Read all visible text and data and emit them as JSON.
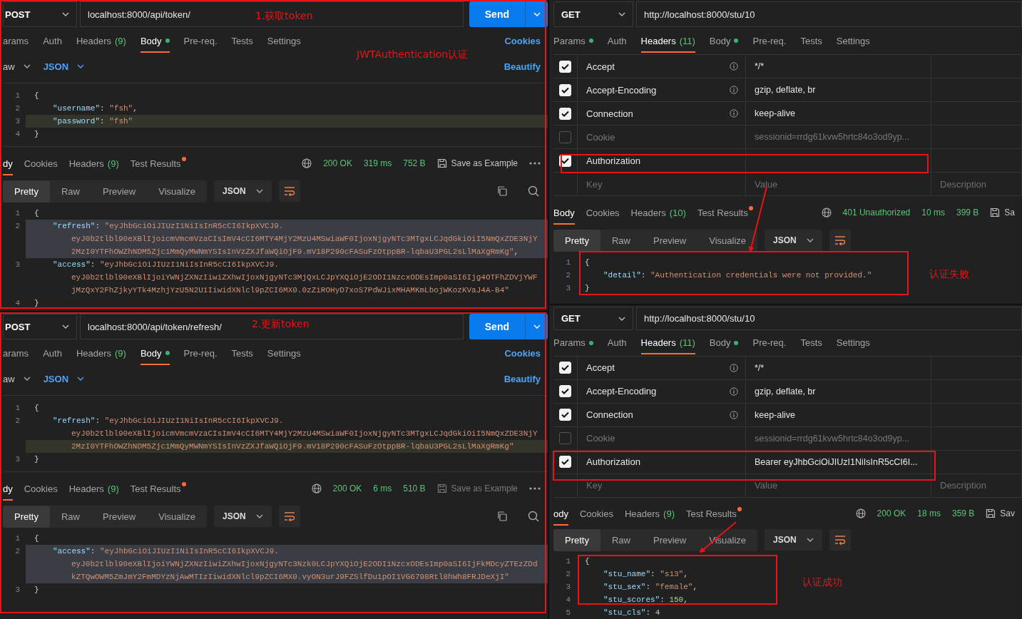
{
  "panels": [
    {
      "kind": "body",
      "method": "POST",
      "url": "localhost:8000/api/token/",
      "send": "Send",
      "tabs": [
        {
          "label": "arams",
          "dot": false,
          "selected": false
        },
        {
          "label": "Auth",
          "dot": false,
          "selected": false
        },
        {
          "label": "Headers",
          "count": "(9)",
          "dot": false,
          "selected": false
        },
        {
          "label": "Body",
          "dot": true,
          "selected": true
        },
        {
          "label": "Pre-req.",
          "dot": false,
          "selected": false
        },
        {
          "label": "Tests",
          "dot": false,
          "selected": false
        },
        {
          "label": "Settings",
          "dot": false,
          "selected": false
        }
      ],
      "cookies_link": "Cookies",
      "body_mode": "aw",
      "body_format": "JSON",
      "beautify": "Beautify",
      "editor": [
        {
          "number": "1",
          "kind": "brace",
          "selected": false,
          "current": false,
          "segments": [
            {
              "kind": "punct",
              "text": "{"
            }
          ]
        },
        {
          "number": "2",
          "kind": "entry",
          "selected": false,
          "current": false,
          "segments": [
            {
              "kind": "key",
              "text": "\"username\""
            },
            {
              "kind": "punct",
              "text": ": "
            },
            {
              "kind": "string",
              "text": "\"fsh\""
            },
            {
              "kind": "punct",
              "text": ","
            }
          ]
        },
        {
          "number": "3",
          "kind": "entry",
          "selected": false,
          "current": true,
          "segments": [
            {
              "kind": "key",
              "text": "\"password\""
            },
            {
              "kind": "punct",
              "text": ": "
            },
            {
              "kind": "string",
              "text": "\"fsh\""
            }
          ]
        },
        {
          "number": "4",
          "kind": "brace",
          "selected": false,
          "current": false,
          "segments": [
            {
              "kind": "punct",
              "text": "}"
            }
          ]
        }
      ],
      "response": {
        "tabs": [
          {
            "label": "dy",
            "dot": false,
            "selected": true
          },
          {
            "label": "Cookies",
            "dot": false,
            "selected": false
          },
          {
            "label": "Headers",
            "count": "(9)",
            "dot": false,
            "selected": false
          },
          {
            "label": "Test Results",
            "dot": true,
            "selected": false
          }
        ],
        "status": "200 OK",
        "time": "319 ms",
        "size": "752 B",
        "save": "Save as Example",
        "save_disabled": false,
        "views": [
          {
            "label": "Pretty",
            "selected": true
          },
          {
            "label": "Raw",
            "selected": false
          },
          {
            "label": "Preview",
            "selected": false
          },
          {
            "label": "Visualize",
            "selected": false
          }
        ],
        "format": "JSON",
        "tools": true,
        "lines": [
          {
            "number": "1",
            "kind": "brace",
            "selected": false,
            "current": false,
            "segments": [
              {
                "kind": "punct",
                "text": "{"
              }
            ]
          },
          {
            "number": "2",
            "kind": "entry",
            "selected": true,
            "current": false,
            "segments": [
              {
                "kind": "key",
                "text": "\"refresh\""
              },
              {
                "kind": "punct",
                "text": ": "
              },
              {
                "kind": "string",
                "text": "\"eyJhbGciOiJIUzI1NiIsInR5cCI6IkpXVCJ9."
              }
            ]
          },
          {
            "kind": "wrap",
            "selected": true,
            "current": false,
            "segments": [
              {
                "kind": "string",
                "text": "eyJ0b2tlbl90eXBlIjoicmVmcmVzaCIsImV4cCI6MTY4MjY2MzU4MSwiaWF0IjoxNjgyNTc3MTgxLCJqdGkiOiI5NmQxZDE3NjY"
              }
            ]
          },
          {
            "kind": "wrap",
            "selected": true,
            "current": false,
            "segments": [
              {
                "kind": "string",
                "text": "2MzI0YTFhOWZhNDM5Zjc1MmQyMWNmYSIsInVzZXJfaWQiOjF9.mV18P290cFASuFzOtppBR-lqbaU3PGL2sLlMaXgRmKg\""
              },
              {
                "kind": "punct",
                "text": ","
              }
            ]
          },
          {
            "number": "3",
            "kind": "entry",
            "selected": false,
            "current": false,
            "segments": [
              {
                "kind": "key",
                "text": "\"access\""
              },
              {
                "kind": "punct",
                "text": ": "
              },
              {
                "kind": "string",
                "text": "\"eyJhbGciOiJIUzI1NiIsInR5cCI6IkpXVCJ9."
              }
            ]
          },
          {
            "kind": "wrap",
            "selected": false,
            "current": false,
            "segments": [
              {
                "kind": "string",
                "text": "eyJ0b2tlbl90eXBlIjoiYWNjZXNzIiwiZXhwIjoxNjgyNTc3MjQxLCJpYXQiOjE2ODI1NzcxODEsImp0aSI6Ijg4OTFhZDVjYWF"
              }
            ]
          },
          {
            "kind": "wrap",
            "selected": false,
            "current": false,
            "segments": [
              {
                "kind": "string",
                "text": "jMzQxY2FhZjkyYTk4MzhjYzU5N2U1IiwidXNlcl9pZCI6MX0.0zZiROHyD7xoS7PdWJixMHAMKmLbojWKozKVaJ4A-B4\""
              }
            ]
          },
          {
            "number": "4",
            "kind": "brace",
            "selected": false,
            "current": false,
            "segments": [
              {
                "kind": "punct",
                "text": "}"
              }
            ]
          }
        ]
      },
      "annotations": [
        {
          "kind": "box"
        },
        {
          "kind": "text",
          "text": "1.获取token"
        },
        {
          "kind": "text",
          "text": "JWTAuthentication认证"
        }
      ]
    },
    {
      "kind": "body",
      "method": "POST",
      "url": "localhost:8000/api/token/refresh/",
      "send": "Send",
      "tabs": [
        {
          "label": "arams",
          "dot": false,
          "selected": false
        },
        {
          "label": "Auth",
          "dot": false,
          "selected": false
        },
        {
          "label": "Headers",
          "count": "(9)",
          "dot": false,
          "selected": false
        },
        {
          "label": "Body",
          "dot": true,
          "selected": true
        },
        {
          "label": "Pre-req.",
          "dot": false,
          "selected": false
        },
        {
          "label": "Tests",
          "dot": false,
          "selected": false
        },
        {
          "label": "Settings",
          "dot": false,
          "selected": false
        }
      ],
      "cookies_link": "Cookies",
      "body_mode": "aw",
      "body_format": "JSON",
      "beautify": "Beautify",
      "editor": [
        {
          "number": "1",
          "kind": "brace",
          "selected": false,
          "current": false,
          "segments": [
            {
              "kind": "punct",
              "text": "{"
            }
          ]
        },
        {
          "number": "2",
          "kind": "entry",
          "selected": false,
          "current": false,
          "segments": [
            {
              "kind": "key",
              "text": "\"refresh\""
            },
            {
              "kind": "punct",
              "text": ": "
            },
            {
              "kind": "string",
              "text": "\"eyJhbGciOiJIUzI1NiIsInR5cCI6IkpXVCJ9."
            }
          ]
        },
        {
          "kind": "wrap",
          "selected": false,
          "current": false,
          "segments": [
            {
              "kind": "string",
              "text": "eyJ0b2tlbl90eXBlIjoicmVmcmVzaCIsImV4cCI6MTY4MjY2MzU4MSwiaWF0IjoxNjgyNTc3MTgxLCJqdGkiOiI5NmQxZDE3NjY"
            }
          ]
        },
        {
          "kind": "wrap",
          "selected": false,
          "current": true,
          "segments": [
            {
              "kind": "string",
              "text": "2MzI0YTFhOWZhNDM5Zjc1MmQyMWNmYSIsInVzZXJfaWQiOjF9.mV18P290cFASuFzOtppBR-lqbaU3PGL2sLlMaXgRmKg\""
            }
          ]
        },
        {
          "number": "3",
          "kind": "brace",
          "selected": false,
          "current": false,
          "segments": [
            {
              "kind": "punct",
              "text": "}"
            }
          ]
        }
      ],
      "response": {
        "tabs": [
          {
            "label": "dy",
            "dot": false,
            "selected": true
          },
          {
            "label": "Cookies",
            "dot": false,
            "selected": false
          },
          {
            "label": "Headers",
            "count": "(9)",
            "dot": false,
            "selected": false
          },
          {
            "label": "Test Results",
            "dot": true,
            "selected": false
          }
        ],
        "status": "200 OK",
        "time": "6 ms",
        "size": "510 B",
        "save": "Save as Example",
        "save_disabled": true,
        "views": [
          {
            "label": "Pretty",
            "selected": true
          },
          {
            "label": "Raw",
            "selected": false
          },
          {
            "label": "Preview",
            "selected": false
          },
          {
            "label": "Visualize",
            "selected": false
          }
        ],
        "format": "JSON",
        "tools": true,
        "lines": [
          {
            "number": "1",
            "kind": "brace",
            "selected": false,
            "current": false,
            "segments": [
              {
                "kind": "punct",
                "text": "{"
              }
            ]
          },
          {
            "number": "2",
            "kind": "entry",
            "selected": true,
            "current": false,
            "segments": [
              {
                "kind": "key",
                "text": "\"access\""
              },
              {
                "kind": "punct",
                "text": ": "
              },
              {
                "kind": "string",
                "text": "\"eyJhbGciOiJIUzI1NiIsInR5cCI6IkpXVCJ9."
              }
            ]
          },
          {
            "kind": "wrap",
            "selected": true,
            "current": false,
            "segments": [
              {
                "kind": "string",
                "text": "eyJ0b2tlbl90eXBlIjoiYWNjZXNzIiwiZXhwIjoxNjgyNTc3Nzk0LCJpYXQiOjE2ODI1NzcxODEsImp0aSI6IjFkMDcyZTEzZDd"
              }
            ]
          },
          {
            "kind": "wrap",
            "selected": true,
            "current": false,
            "segments": [
              {
                "kind": "string",
                "text": "kZTQwOWM5ZmJmY2FmMDYzNjAwMTIzIiwidXNlcl9pZCI6MX0.vyON3urJ9FZSlfDu1pOI1VG6798Rtl8hWh8FRJDeXjI\""
              }
            ]
          },
          {
            "number": "3",
            "kind": "brace",
            "selected": false,
            "current": false,
            "segments": [
              {
                "kind": "punct",
                "text": "}"
              }
            ]
          }
        ]
      },
      "annotations": [
        {
          "kind": "box"
        },
        {
          "kind": "text",
          "text": "2.更新token"
        }
      ]
    },
    {
      "kind": "headers",
      "method": "GET",
      "url": "http://localhost:8000/stu/10",
      "tabs": [
        {
          "label": "Params",
          "dot": true,
          "selected": false
        },
        {
          "label": "Auth",
          "dot": false,
          "selected": false
        },
        {
          "label": "Headers",
          "count": "(11)",
          "dot": false,
          "selected": true
        },
        {
          "label": "Body",
          "dot": true,
          "selected": false
        },
        {
          "label": "Pre-req.",
          "dot": false,
          "selected": false
        },
        {
          "label": "Tests",
          "dot": false,
          "selected": false
        },
        {
          "label": "Settings",
          "dot": false,
          "selected": false
        }
      ],
      "headers": [
        {
          "checked": true,
          "key": "Accept",
          "info": true,
          "value": "*/*"
        },
        {
          "checked": true,
          "key": "Accept-Encoding",
          "info": true,
          "value": "gzip, deflate, br"
        },
        {
          "checked": true,
          "key": "Connection",
          "info": true,
          "value": "keep-alive"
        },
        {
          "checked": false,
          "key": "Cookie",
          "info": false,
          "value": "sessionid=rrdg61kvw5hrtc84o3od9yp..."
        },
        {
          "checked": true,
          "key": "Authorization",
          "info": false
        }
      ],
      "placeholder": {
        "key": "Key",
        "value": "Value",
        "description": "Description"
      },
      "response": {
        "tabs": [
          {
            "label": "Body",
            "dot": false,
            "selected": true
          },
          {
            "label": "Cookies",
            "dot": false,
            "selected": false
          },
          {
            "label": "Headers",
            "count": "(10)",
            "dot": false,
            "selected": false
          },
          {
            "label": "Test Results",
            "dot": true,
            "selected": false
          }
        ],
        "status": "401 Unauthorized",
        "time": "10 ms",
        "size": "399 B",
        "save": "Sa",
        "save_disabled": false,
        "views": [
          {
            "label": "Pretty",
            "selected": true
          },
          {
            "label": "Raw",
            "selected": false
          },
          {
            "label": "Preview",
            "selected": false
          },
          {
            "label": "Visualize",
            "selected": false
          }
        ],
        "format": "JSON",
        "tools": false,
        "lines": [
          {
            "number": "1",
            "kind": "brace",
            "selected": false,
            "current": false,
            "segments": [
              {
                "kind": "punct",
                "text": "{"
              }
            ]
          },
          {
            "number": "2",
            "kind": "entry",
            "selected": false,
            "current": false,
            "segments": [
              {
                "kind": "key",
                "text": "\"detail\""
              },
              {
                "kind": "punct",
                "text": ": "
              },
              {
                "kind": "string",
                "text": "\"Authentication credentials were not provided.\""
              }
            ]
          },
          {
            "number": "3",
            "kind": "brace",
            "selected": false,
            "current": false,
            "segments": [
              {
                "kind": "punct",
                "text": "}"
              }
            ]
          }
        ]
      },
      "annotations": [
        {
          "kind": "box"
        },
        {
          "kind": "arrow"
        },
        {
          "kind": "box"
        },
        {
          "kind": "text",
          "text": "认证失败"
        }
      ]
    },
    {
      "kind": "headers",
      "method": "GET",
      "url": "http://localhost:8000/stu/10",
      "tabs": [
        {
          "label": "Params",
          "dot": true,
          "selected": false
        },
        {
          "label": "Auth",
          "dot": false,
          "selected": false
        },
        {
          "label": "Headers",
          "count": "(11)",
          "dot": false,
          "selected": true
        },
        {
          "label": "Body",
          "dot": true,
          "selected": false
        },
        {
          "label": "Pre-req.",
          "dot": false,
          "selected": false
        },
        {
          "label": "Tests",
          "dot": false,
          "selected": false
        },
        {
          "label": "Settings",
          "dot": false,
          "selected": false
        }
      ],
      "headers": [
        {
          "checked": true,
          "key": "Accept",
          "info": true,
          "value": "*/*"
        },
        {
          "checked": true,
          "key": "Accept-Encoding",
          "info": true,
          "value": "gzip, deflate, br"
        },
        {
          "checked": true,
          "key": "Connection",
          "info": true,
          "value": "keep-alive"
        },
        {
          "checked": false,
          "key": "Cookie",
          "info": false,
          "value": "sessionid=rrdg61kvw5hrtc84o3od9yp..."
        },
        {
          "checked": true,
          "key": "Authorization",
          "info": false,
          "value": "Bearer eyJhbGciOiJIUzI1NiIsInR5cCI6I..."
        }
      ],
      "placeholder": {
        "key": "Key",
        "value": "Value",
        "description": "Description"
      },
      "response": {
        "tabs": [
          {
            "label": "ody",
            "dot": false,
            "selected": true
          },
          {
            "label": "Cookies",
            "dot": false,
            "selected": false
          },
          {
            "label": "Headers",
            "count": "(9)",
            "dot": false,
            "selected": false
          },
          {
            "label": "Test Results",
            "dot": true,
            "selected": false
          }
        ],
        "status": "200 OK",
        "time": "18 ms",
        "size": "359 B",
        "save": "Sav",
        "save_disabled": false,
        "views": [
          {
            "label": "Pretty",
            "selected": true
          },
          {
            "label": "Raw",
            "selected": false
          },
          {
            "label": "Preview",
            "selected": false
          },
          {
            "label": "Visualize",
            "selected": false
          }
        ],
        "format": "JSON",
        "tools": false,
        "lines": [
          {
            "number": "1",
            "kind": "brace",
            "selected": false,
            "current": false,
            "segments": [
              {
                "kind": "punct",
                "text": "{"
              }
            ]
          },
          {
            "number": "2",
            "kind": "entry",
            "selected": false,
            "current": false,
            "segments": [
              {
                "kind": "key",
                "text": "\"stu_name\""
              },
              {
                "kind": "punct",
                "text": ": "
              },
              {
                "kind": "string",
                "text": "\"s13\""
              },
              {
                "kind": "punct",
                "text": ","
              }
            ]
          },
          {
            "number": "3",
            "kind": "entry",
            "selected": false,
            "current": false,
            "segments": [
              {
                "kind": "key",
                "text": "\"stu_sex\""
              },
              {
                "kind": "punct",
                "text": ": "
              },
              {
                "kind": "string",
                "text": "\"female\""
              },
              {
                "kind": "punct",
                "text": ","
              }
            ]
          },
          {
            "number": "4",
            "kind": "entry",
            "selected": false,
            "current": false,
            "segments": [
              {
                "kind": "key",
                "text": "\"stu_scores\""
              },
              {
                "kind": "punct",
                "text": ": "
              },
              {
                "kind": "number",
                "text": "150"
              },
              {
                "kind": "punct",
                "text": ","
              }
            ]
          },
          {
            "number": "5",
            "kind": "entry",
            "selected": false,
            "current": false,
            "segments": [
              {
                "kind": "key",
                "text": "\"stu_cls\""
              },
              {
                "kind": "punct",
                "text": ": "
              },
              {
                "kind": "number",
                "text": "4"
              }
            ]
          }
        ]
      },
      "annotations": [
        {
          "kind": "box"
        },
        {
          "kind": "arrow"
        },
        {
          "kind": "box"
        },
        {
          "kind": "text",
          "text": "认证成功"
        }
      ]
    }
  ]
}
